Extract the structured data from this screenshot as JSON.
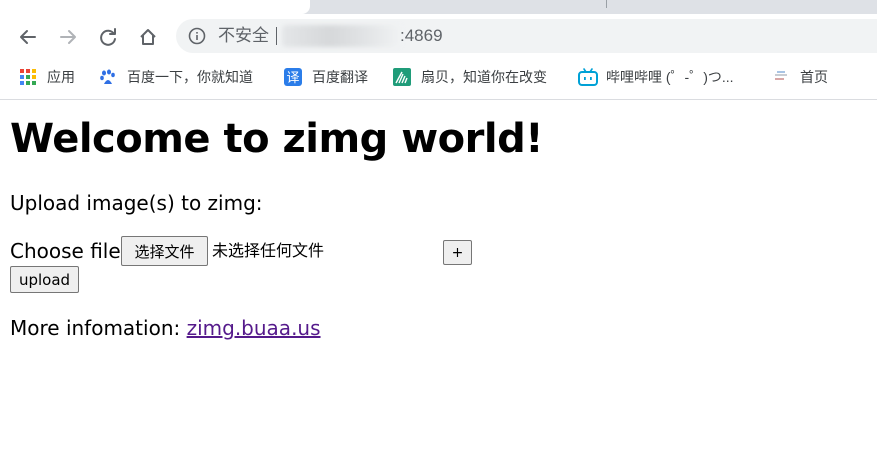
{
  "browser": {
    "omnibox": {
      "security_label": "不安全",
      "address_suffix": ":4869"
    },
    "bookmarks": [
      {
        "label": "应用",
        "icon": "apps-grid-icon"
      },
      {
        "label": "百度一下，你就知道",
        "icon": "baidu-paw-icon"
      },
      {
        "label": "百度翻译",
        "icon": "baidu-translate-icon",
        "glyph": "译"
      },
      {
        "label": "扇贝，知道你在改变",
        "icon": "shanbay-icon"
      },
      {
        "label": "哔哩哔哩 (゜-゜)つ...",
        "icon": "bilibili-tv-icon"
      },
      {
        "label": "首页",
        "icon": "homepage-favicon-icon"
      }
    ],
    "colors": {
      "tabstrip": "#dee1e6",
      "omnibox": "#f1f3f4",
      "link_visited": "#551a8b"
    }
  },
  "page": {
    "heading": "Welcome to zimg world!",
    "upload_prompt": "Upload image(s) to zimg:",
    "choose_label": "Choose file:",
    "choose_button": "选择文件",
    "no_file_text": "未选择任何文件",
    "add_button": "+",
    "upload_button": "upload",
    "more_label": "More infomation:",
    "more_link": "zimg.buaa.us"
  }
}
